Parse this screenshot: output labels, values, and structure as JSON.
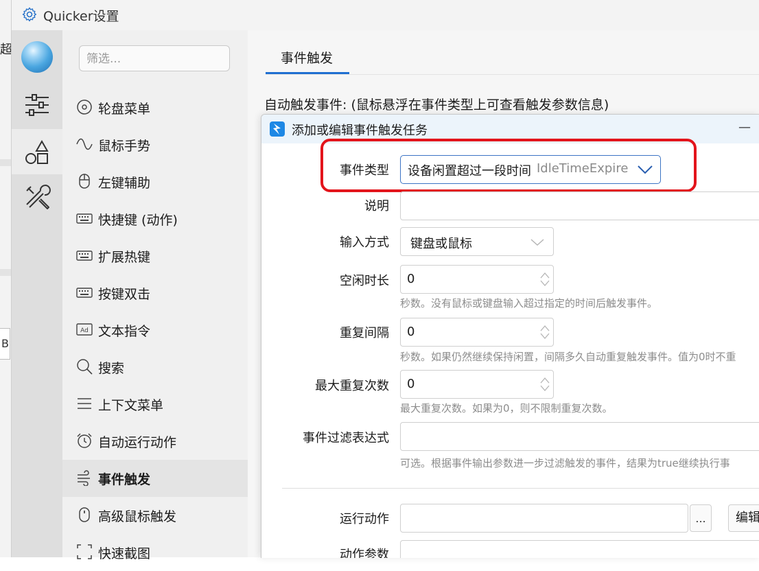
{
  "background": {
    "partial_text": "超",
    "partial_text_2": "B"
  },
  "window": {
    "title": "Quicker设置"
  },
  "rail": {
    "items": [
      {
        "name": "settings-sliders"
      },
      {
        "name": "shapes"
      },
      {
        "name": "tools"
      }
    ],
    "active_index": 1
  },
  "nav": {
    "filter_placeholder": "筛选...",
    "items": [
      {
        "label": "轮盘菜单",
        "icon": "wheel-icon"
      },
      {
        "label": "鼠标手势",
        "icon": "gesture-icon"
      },
      {
        "label": "左键辅助",
        "icon": "mouse-icon"
      },
      {
        "label": "快捷键 (动作)",
        "icon": "keyboard-icon"
      },
      {
        "label": "扩展热键",
        "icon": "keyboard-icon"
      },
      {
        "label": "按键双击",
        "icon": "keyboard-icon"
      },
      {
        "label": "文本指令",
        "icon": "ad-icon"
      },
      {
        "label": "搜索",
        "icon": "search-icon"
      },
      {
        "label": "上下文菜单",
        "icon": "menu-icon"
      },
      {
        "label": "自动运行动作",
        "icon": "alarm-icon"
      },
      {
        "label": "事件触发",
        "icon": "wind-icon"
      },
      {
        "label": "高级鼠标触发",
        "icon": "mouse-icon"
      },
      {
        "label": "快速截图",
        "icon": "screenshot-icon"
      }
    ],
    "active_index": 10
  },
  "content": {
    "tab_label": "事件触发",
    "auto_label": "自动触发事件:  (鼠标悬浮在事件类型上可查看触发参数信息)"
  },
  "dialog": {
    "title": "添加或编辑事件触发任务",
    "minimize": "—",
    "event_type": {
      "label": "事件类型",
      "value": "设备闲置超过一段时间",
      "code": "IdleTimeExpire"
    },
    "description": {
      "label": "说明",
      "value": ""
    },
    "input_method": {
      "label": "输入方式",
      "value": "键盘或鼠标"
    },
    "idle_duration": {
      "label": "空闲时长",
      "value": "0",
      "hint": "秒数。没有鼠标或键盘输入超过指定的时间后触发事件。"
    },
    "repeat_interval": {
      "label": "重复间隔",
      "value": "0",
      "hint": "秒数。如果仍然继续保持闲置，间隔多久自动重复触发事件。值为0时不重"
    },
    "max_repeat": {
      "label": "最大重复次数",
      "value": "0",
      "hint": "最大重复次数。如果为0，则不限制重复次数。"
    },
    "filter_expr": {
      "label": "事件过滤表达式",
      "value": "",
      "hint": "可选。根据事件输出参数进一步过滤触发的事件，结果为true继续执行事"
    },
    "run_action": {
      "label": "运行动作",
      "value": "",
      "ellipsis": "...",
      "edit": "编辑"
    },
    "action_params": {
      "label": "动作参数",
      "value": ""
    }
  },
  "colors": {
    "accent": "#1f6fd1",
    "highlight": "#e3141b"
  }
}
